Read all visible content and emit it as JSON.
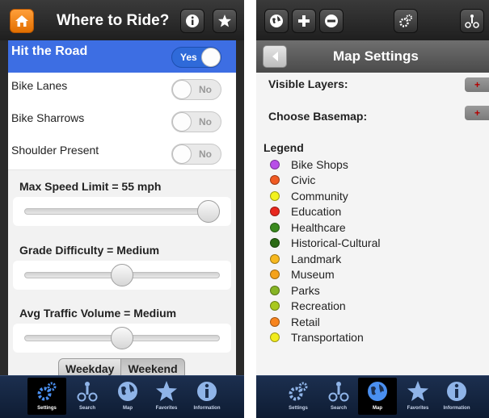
{
  "left_screen": {
    "header": {
      "title": "Where to Ride?"
    },
    "toggles": [
      {
        "label": "Hit the Road",
        "state": "Yes",
        "on": true
      },
      {
        "label": "Bike Lanes",
        "state": "No",
        "on": false
      },
      {
        "label": "Bike Sharrows",
        "state": "No",
        "on": false
      },
      {
        "label": "Shoulder Present",
        "state": "No",
        "on": false
      }
    ],
    "sliders": [
      {
        "label": "Max Speed Limit = 55 mph",
        "level": 1.0
      },
      {
        "label": "Grade Difficulty = Medium",
        "level": 0.5
      },
      {
        "label": "Avg Traffic Volume = Medium",
        "level": 0.5
      }
    ],
    "segment": {
      "options": [
        "Weekday",
        "Weekend"
      ],
      "selected": "Weekend"
    },
    "tabs": [
      {
        "label": "Settings",
        "icon": "gears-icon"
      },
      {
        "label": "Search",
        "icon": "cyclist-icon"
      },
      {
        "label": "Map",
        "icon": "globe-icon"
      },
      {
        "label": "Favorites",
        "icon": "star-icon"
      },
      {
        "label": "Information",
        "icon": "info-icon"
      }
    ],
    "active_tab": "Settings"
  },
  "right_screen": {
    "navbar": {
      "title": "Map Settings"
    },
    "sections": {
      "visible_layers": "Visible Layers:",
      "choose_basemap": "Choose Basemap:",
      "expand_symbol": "+"
    },
    "legend": {
      "title": "Legend",
      "items": [
        {
          "label": "Bike Shops",
          "color": "#b84ee8"
        },
        {
          "label": "Civic",
          "color": "#f05a22"
        },
        {
          "label": "Community",
          "color": "#f2f21c"
        },
        {
          "label": "Education",
          "color": "#e8281e"
        },
        {
          "label": "Healthcare",
          "color": "#3a8a1e"
        },
        {
          "label": "Historical-Cultural",
          "color": "#2a6a14"
        },
        {
          "label": "Landmark",
          "color": "#f7b81e"
        },
        {
          "label": "Museum",
          "color": "#f5a21a"
        },
        {
          "label": "Parks",
          "color": "#86b424"
        },
        {
          "label": "Recreation",
          "color": "#a8c81e"
        },
        {
          "label": "Retail",
          "color": "#f7841e"
        },
        {
          "label": "Transportation",
          "color": "#f2ec1c"
        }
      ]
    },
    "tabs": [
      {
        "label": "Settings",
        "icon": "gears-icon"
      },
      {
        "label": "Search",
        "icon": "cyclist-icon"
      },
      {
        "label": "Map",
        "icon": "globe-icon"
      },
      {
        "label": "Favorites",
        "icon": "star-icon"
      },
      {
        "label": "Information",
        "icon": "info-icon"
      }
    ],
    "active_tab": "Map"
  }
}
